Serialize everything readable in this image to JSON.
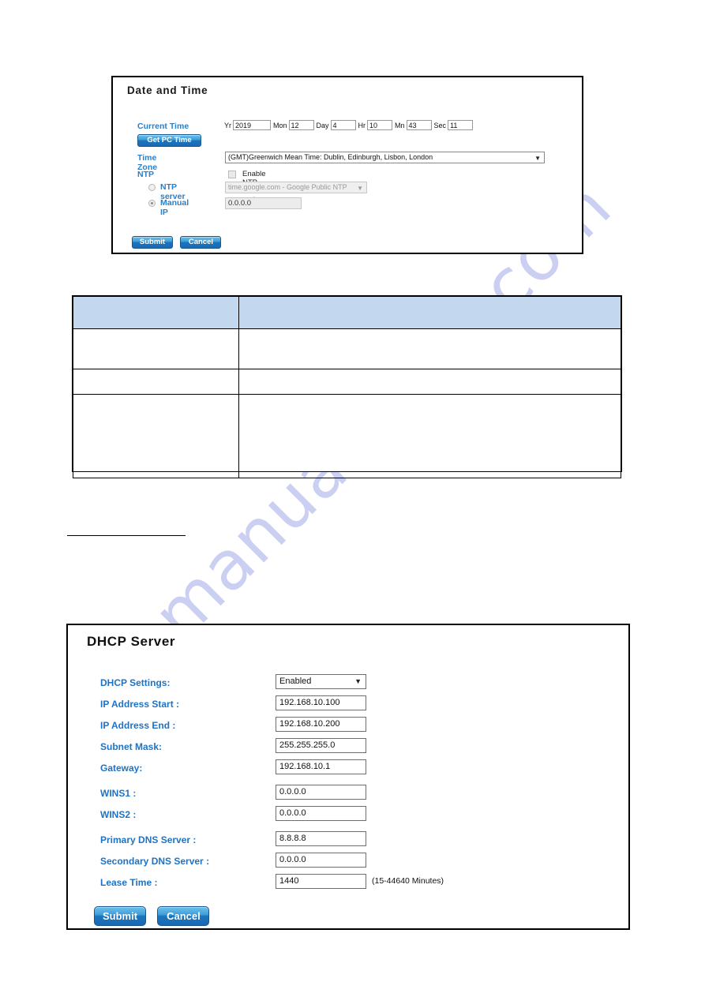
{
  "date_time_panel": {
    "title": "Date and Time",
    "current_time": {
      "label": "Current Time",
      "units": [
        {
          "name": "year",
          "label": "Yr",
          "value": "2019"
        },
        {
          "name": "month",
          "label": "Mon",
          "value": "12"
        },
        {
          "name": "day",
          "label": "Day",
          "value": "4"
        },
        {
          "name": "hour",
          "label": "Hr",
          "value": "10"
        },
        {
          "name": "minute",
          "label": "Mn",
          "value": "43"
        },
        {
          "name": "second",
          "label": "Sec",
          "value": "11"
        }
      ]
    },
    "get_pc_time_button": "Get PC Time",
    "time_zone": {
      "label": "Time Zone",
      "selected": "(GMT)Greenwich Mean Time: Dublin, Edinburgh, Lisbon, London",
      "caret": "▼"
    },
    "ntp": {
      "label": "NTP",
      "enable_checkbox_label": "Enable NTP client update",
      "enabled": false
    },
    "ntp_server": {
      "label": "NTP server",
      "selected": "time.google.com - Google Public NTP",
      "caret": "▼",
      "radio_selected": false
    },
    "manual_ip": {
      "label": "Manual IP",
      "value": "0.0.0.0",
      "radio_selected": true
    },
    "submit_label": "Submit",
    "cancel_label": "Cancel"
  },
  "description_table": {
    "headers": [
      "",
      ""
    ],
    "rows": [
      [
        "",
        ""
      ],
      [
        "",
        ""
      ],
      [
        "",
        ""
      ]
    ]
  },
  "section_heading": {
    "text": ""
  },
  "dhcp_panel": {
    "title": "DHCP Server",
    "fields": [
      {
        "name": "dhcp-settings",
        "label": "DHCP Settings:",
        "value": "Enabled",
        "type": "select",
        "caret": "▼",
        "hint": ""
      },
      {
        "name": "ip-address-start",
        "label": "IP Address Start :",
        "value": "192.168.10.100",
        "type": "text",
        "caret": "",
        "hint": ""
      },
      {
        "name": "ip-address-end",
        "label": "IP Address End :",
        "value": "192.168.10.200",
        "type": "text",
        "caret": "",
        "hint": ""
      },
      {
        "name": "subnet-mask",
        "label": "Subnet Mask:",
        "value": "255.255.255.0",
        "type": "text",
        "caret": "",
        "hint": ""
      },
      {
        "name": "gateway",
        "label": "Gateway:",
        "value": "192.168.10.1",
        "type": "text",
        "caret": "",
        "hint": ""
      },
      {
        "name": "wins1",
        "label": "WINS1 :",
        "value": "0.0.0.0",
        "type": "text",
        "caret": "",
        "hint": ""
      },
      {
        "name": "wins2",
        "label": "WINS2 :",
        "value": "0.0.0.0",
        "type": "text",
        "caret": "",
        "hint": ""
      },
      {
        "name": "primary-dns-server",
        "label": "Primary DNS Server :",
        "value": "8.8.8.8",
        "type": "text",
        "caret": "",
        "hint": ""
      },
      {
        "name": "secondary-dns-server",
        "label": "Secondary DNS Server :",
        "value": "0.0.0.0",
        "type": "text",
        "caret": "",
        "hint": ""
      },
      {
        "name": "lease-time",
        "label": "Lease Time :",
        "value": "1440",
        "type": "text",
        "caret": "",
        "hint": "(15-44640 Minutes)"
      }
    ],
    "submit_label": "Submit",
    "cancel_label": "Cancel"
  },
  "watermark": {
    "text": "manualshive.com",
    "color": "#c9cdf2"
  },
  "colors": {
    "label_blue": "#2a7fc9",
    "dhcp_label_blue": "#1e73c4",
    "button_blue": "#1d75bd",
    "table_header": "#c3d8ef",
    "border_black": "#000000"
  }
}
